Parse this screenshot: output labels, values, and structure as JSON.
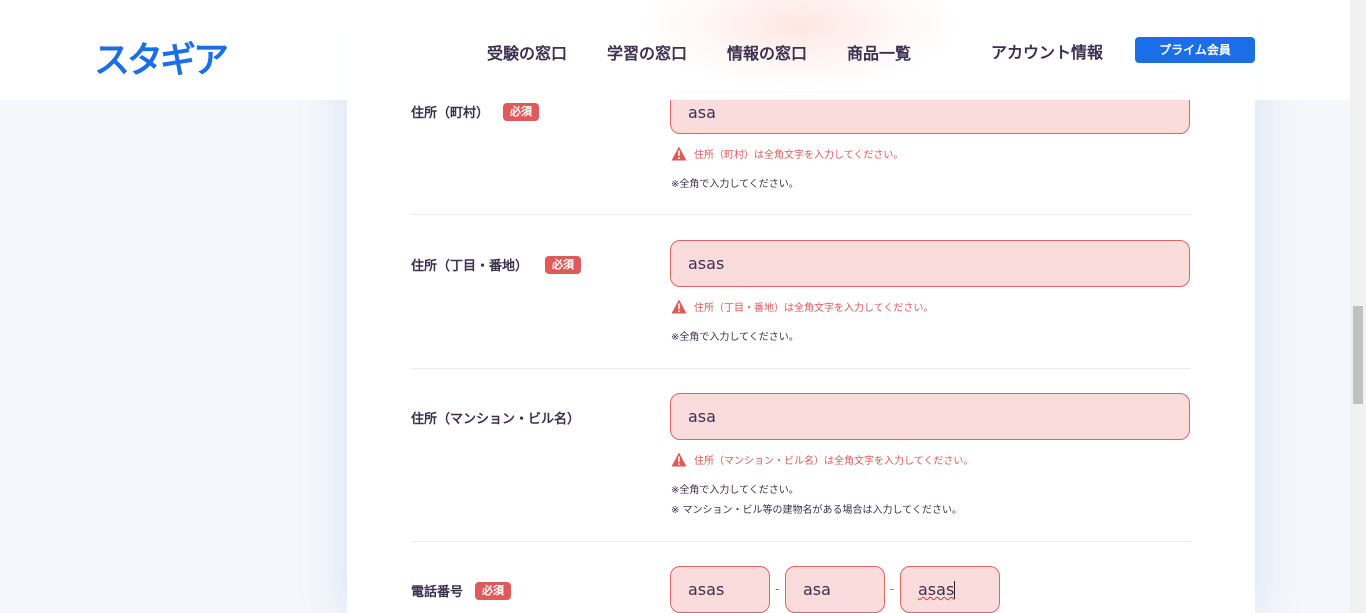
{
  "header": {
    "logo": "スタギア",
    "nav": [
      "受験の窓口",
      "学習の窓口",
      "情報の窓口",
      "商品一覧"
    ],
    "account": "アカウント情報",
    "premium": "プライム会員"
  },
  "colors": {
    "brand": "#1a6fe8",
    "error": "#df5a5a",
    "field_bg": "#fadcdc"
  },
  "required_badge": "必須",
  "rows": [
    {
      "label": "住所（町村）",
      "value": "asa",
      "error": "住所（町村）は全角文字を入力してください。",
      "note": "※全角で入力してください。"
    },
    {
      "label": "住所（丁目・番地）",
      "value": "asas",
      "error": "住所（丁目・番地）は全角文字を入力してください。",
      "note": "※全角で入力してください。"
    },
    {
      "label": "住所（マンション・ビル名）",
      "value": "asa",
      "error": "住所（マンション・ビル名）は全角文字を入力してください。",
      "note": "※全角で入力してください。",
      "note2": "※ マンション・ビル等の建物名がある場合は入力してください。"
    }
  ],
  "phone": {
    "label": "電話番号",
    "values": [
      "asas",
      "asa",
      "asas"
    ],
    "separator": "-"
  }
}
